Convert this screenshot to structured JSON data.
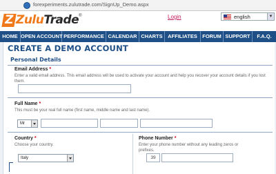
{
  "browser": {
    "url": "forexperiments.zulutrade.com/SignUp_Demo.aspx"
  },
  "header": {
    "logo_part1": "Zulu",
    "logo_part2": "Trade",
    "logo_tm": "®",
    "login_link": "Login",
    "language": "english"
  },
  "nav": {
    "items": [
      "HOME",
      "OPEN ACCOUNT",
      "PERFORMANCE",
      "CALENDAR",
      "CHARTS",
      "AFFILIATES",
      "FORUM",
      "SUPPORT",
      "F.A.Q."
    ]
  },
  "form": {
    "title": "CREATE A DEMO ACCOUNT",
    "section": "Personal Details",
    "email": {
      "label": "Email Address",
      "required": "*",
      "hint": "Enter a valid email address. This email address will be used to activate your account and help you recover your account details if you lost them."
    },
    "fullname": {
      "label": "Full Name",
      "required": "*",
      "hint": "This must be your real full name (first name, middle name and last name).",
      "title_value": "Mr"
    },
    "country": {
      "label": "Country",
      "required": "*",
      "hint": "Choose your country.",
      "value": "Italy"
    },
    "phone": {
      "label": "Phone Number",
      "required": "*",
      "hint": "Enter your phone number without any leading zeros or prefixes.",
      "prefix": "39"
    }
  },
  "colors": {
    "nav_bg": "#1e4f86",
    "brand_orange": "#f07a1a",
    "required_red": "#d0021b"
  }
}
